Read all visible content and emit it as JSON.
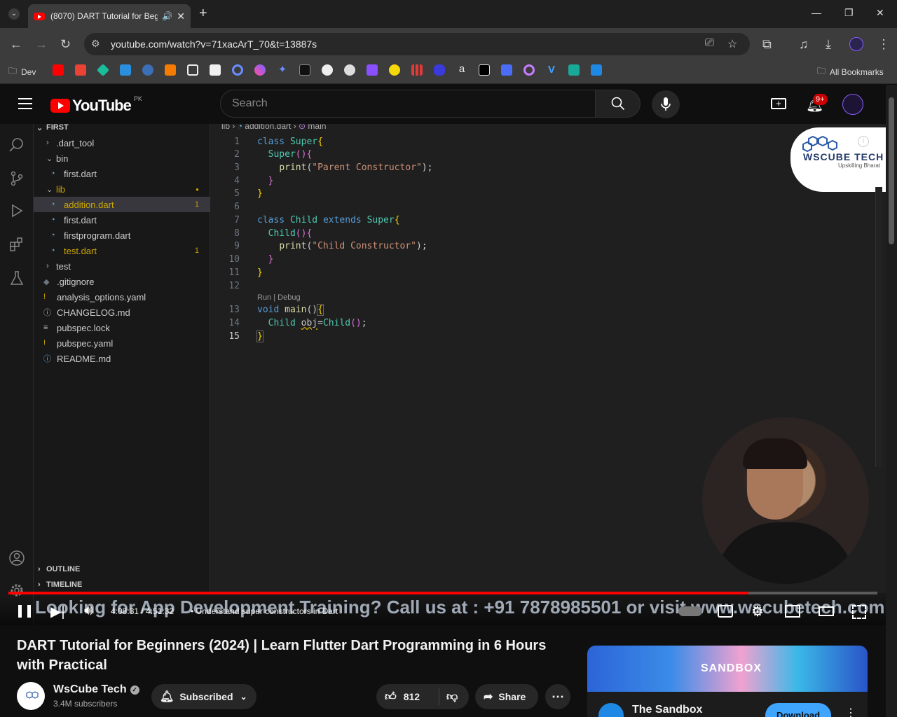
{
  "browser": {
    "tab_title": "(8070) DART Tutorial for Beg",
    "url": "youtube.com/watch?v=71xacArT_70&t=13887s",
    "bookmark_folder": "Dev",
    "all_bookmarks": "All Bookmarks"
  },
  "youtube": {
    "logo_text": "YouTube",
    "country": "PK",
    "search_placeholder": "Search",
    "notification_count": "9+"
  },
  "vscode": {
    "root_folder": "FIRST",
    "breadcrumb_lib": "lib",
    "breadcrumb_file": "addition.dart",
    "breadcrumb_symbol": "main",
    "tree": [
      {
        "label": ".dart_tool",
        "type": "folder-closed"
      },
      {
        "label": "bin",
        "type": "folder-open"
      },
      {
        "label": "first.dart",
        "type": "dart"
      },
      {
        "label": "lib",
        "type": "folder-open"
      },
      {
        "label": "addition.dart",
        "type": "dart",
        "badge": "1"
      },
      {
        "label": "first.dart",
        "type": "dart"
      },
      {
        "label": "firstprogram.dart",
        "type": "dart"
      },
      {
        "label": "test.dart",
        "type": "dart",
        "badge": "1"
      },
      {
        "label": "test",
        "type": "folder-closed"
      },
      {
        "label": ".gitignore",
        "type": "file"
      },
      {
        "label": "analysis_options.yaml",
        "type": "yaml"
      },
      {
        "label": "CHANGELOG.md",
        "type": "md"
      },
      {
        "label": "pubspec.lock",
        "type": "lock"
      },
      {
        "label": "pubspec.yaml",
        "type": "yaml"
      },
      {
        "label": "README.md",
        "type": "info"
      }
    ],
    "outline": "OUTLINE",
    "timeline": "TIMELINE",
    "codelens": "Run | Debug",
    "code_lines": [
      "1",
      "2",
      "3",
      "4",
      "5",
      "6",
      "7",
      "8",
      "9",
      "10",
      "11",
      "12",
      "13",
      "14",
      "15"
    ]
  },
  "overlay": {
    "brand": "WsCube Tech",
    "tagline": "Upskilling Bharat",
    "marquee": "Looking for App Development Training? Call us at : +91 7878985501 or visit www.wscubetech.com"
  },
  "player": {
    "time": "4:08:31 / 4:51:32",
    "chapter": "• Understand super constructors in Dart",
    "progress_fraction": 0.852
  },
  "video_info": {
    "title": "DART Tutorial for Beginners (2024) | Learn Flutter Dart Programming in 6 Hours with Practical",
    "channel": "WsCube Tech",
    "subscribers": "3.4M subscribers",
    "subscribed_label": "Subscribed",
    "likes": "812",
    "share_label": "Share"
  },
  "ad": {
    "game": "SANDBOX",
    "name": "The Sandbox",
    "cta": "Download"
  }
}
